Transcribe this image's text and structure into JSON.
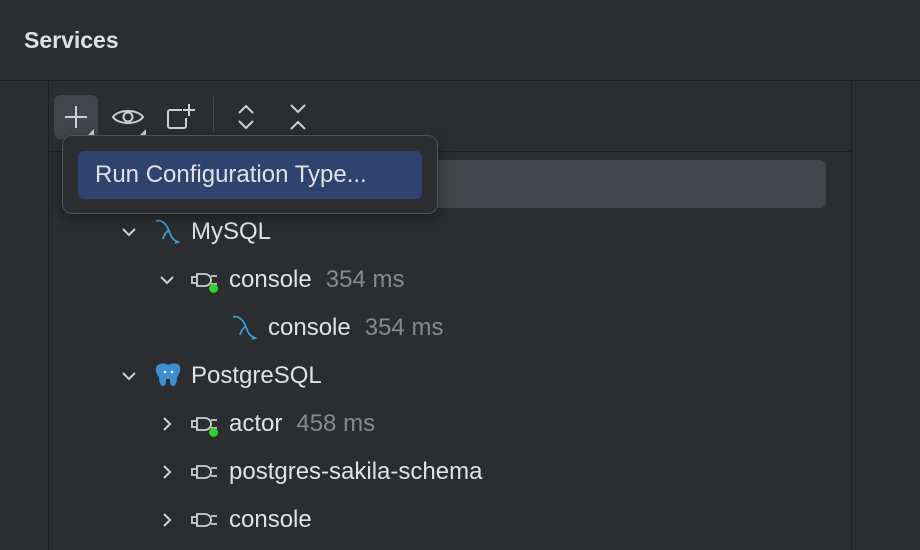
{
  "panel": {
    "title": "Services"
  },
  "toolbar": {
    "add": "add-icon",
    "view": "eye-icon",
    "new_group": "new-group-icon",
    "expand_all": "expand-all-icon",
    "collapse_all": "collapse-all-icon"
  },
  "popup": {
    "item": "Run Configuration Type..."
  },
  "tree": [
    {
      "label": "MySQL",
      "meta": ""
    },
    {
      "label": "console",
      "meta": "354 ms"
    },
    {
      "label": "console",
      "meta": "354 ms"
    },
    {
      "label": "PostgreSQL",
      "meta": ""
    },
    {
      "label": "actor",
      "meta": "458 ms"
    },
    {
      "label": "postgres-sakila-schema",
      "meta": ""
    },
    {
      "label": "console",
      "meta": ""
    }
  ],
  "colors": {
    "selection": "#2e436e",
    "status_connected": "#2fd12f",
    "mysql": "#3c9fdc",
    "postgres": "#3d8fd0"
  }
}
